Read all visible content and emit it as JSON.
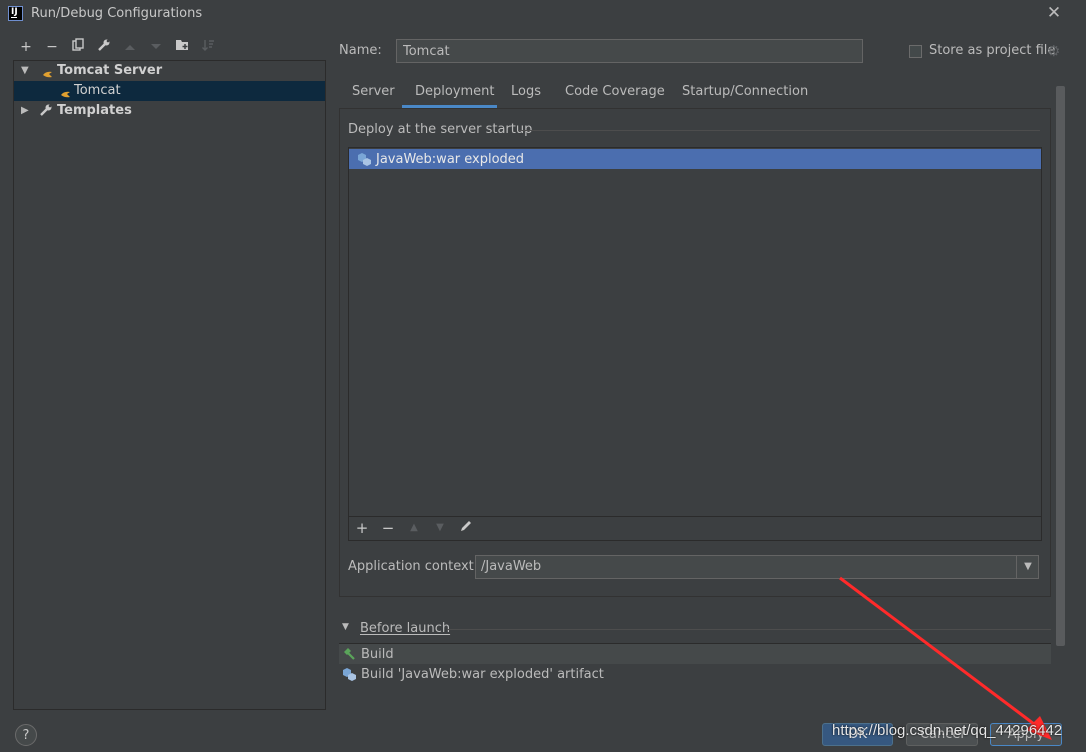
{
  "window": {
    "title": "Run/Debug Configurations"
  },
  "toolbar": {
    "buttons": [
      "add-icon",
      "remove-icon",
      "copy-icon",
      "wrench-icon",
      "move-up-icon",
      "move-down-icon",
      "new-folder-icon",
      "sort-icon"
    ]
  },
  "tree": {
    "group": "Tomcat Server",
    "item": "Tomcat",
    "templates": "Templates"
  },
  "form": {
    "name_label": "Name:",
    "name_value": "Tomcat",
    "store_label": "Store as project file",
    "store_checked": false
  },
  "tabs": [
    {
      "label": "Server",
      "active": false
    },
    {
      "label": "Deployment",
      "active": true
    },
    {
      "label": "Logs",
      "active": false
    },
    {
      "label": "Code Coverage",
      "active": false
    },
    {
      "label": "Startup/Connection",
      "active": false
    }
  ],
  "deployment": {
    "section_title": "Deploy at the server startup",
    "items": [
      "JavaWeb:war exploded"
    ],
    "context_label": "Application context:",
    "context_value": "/JavaWeb"
  },
  "before_launch": {
    "title": "Before launch",
    "items": [
      "Build",
      "Build 'JavaWeb:war exploded' artifact"
    ]
  },
  "buttons": {
    "help": "?",
    "ok": "OK",
    "cancel": "Cancel",
    "apply": "Apply"
  },
  "watermark": "https://blog.csdn.net/qq_44296442",
  "colors": {
    "background": "#3c3f41",
    "selection": "#4b6eaf",
    "tree_selection": "#0d293e",
    "accent": "#4a88c7",
    "annotation": "#ff2a2a"
  }
}
